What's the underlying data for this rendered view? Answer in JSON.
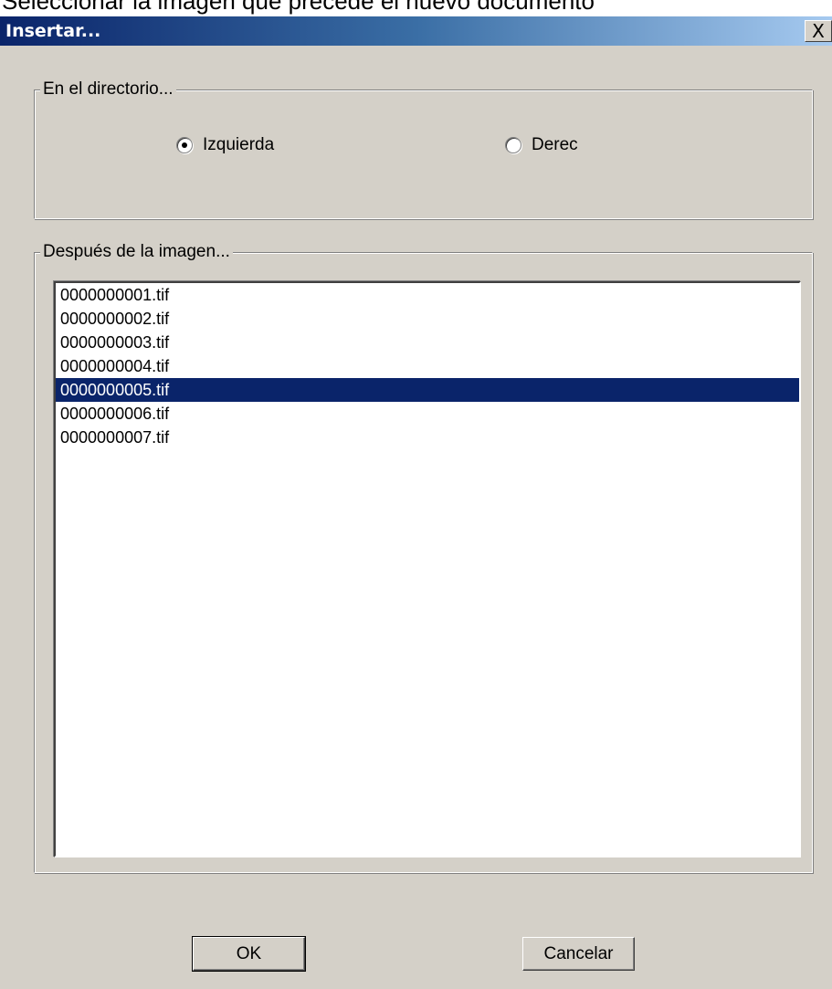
{
  "background_text": "Seleccionar la imagen que precede el nuevo documento",
  "window": {
    "title": "Insertar...",
    "close_label": "X"
  },
  "directory_group": {
    "legend": "En el directorio...",
    "options": [
      {
        "label": "Izquierda",
        "selected": true
      },
      {
        "label": "Derec",
        "selected": false
      }
    ]
  },
  "image_group": {
    "legend": "Después de la imagen...",
    "items": [
      {
        "label": "0000000001.tif",
        "selected": false
      },
      {
        "label": "0000000002.tif",
        "selected": false
      },
      {
        "label": "0000000003.tif",
        "selected": false
      },
      {
        "label": "0000000004.tif",
        "selected": false
      },
      {
        "label": "0000000005.tif",
        "selected": true
      },
      {
        "label": "0000000006.tif",
        "selected": false
      },
      {
        "label": "0000000007.tif",
        "selected": false
      }
    ]
  },
  "buttons": {
    "ok": "OK",
    "cancel": "Cancelar"
  },
  "colors": {
    "dialog_face": "#d4d0c8",
    "titlebar_start": "#0a246a",
    "titlebar_end": "#a6caf0",
    "selection": "#0a246a"
  }
}
